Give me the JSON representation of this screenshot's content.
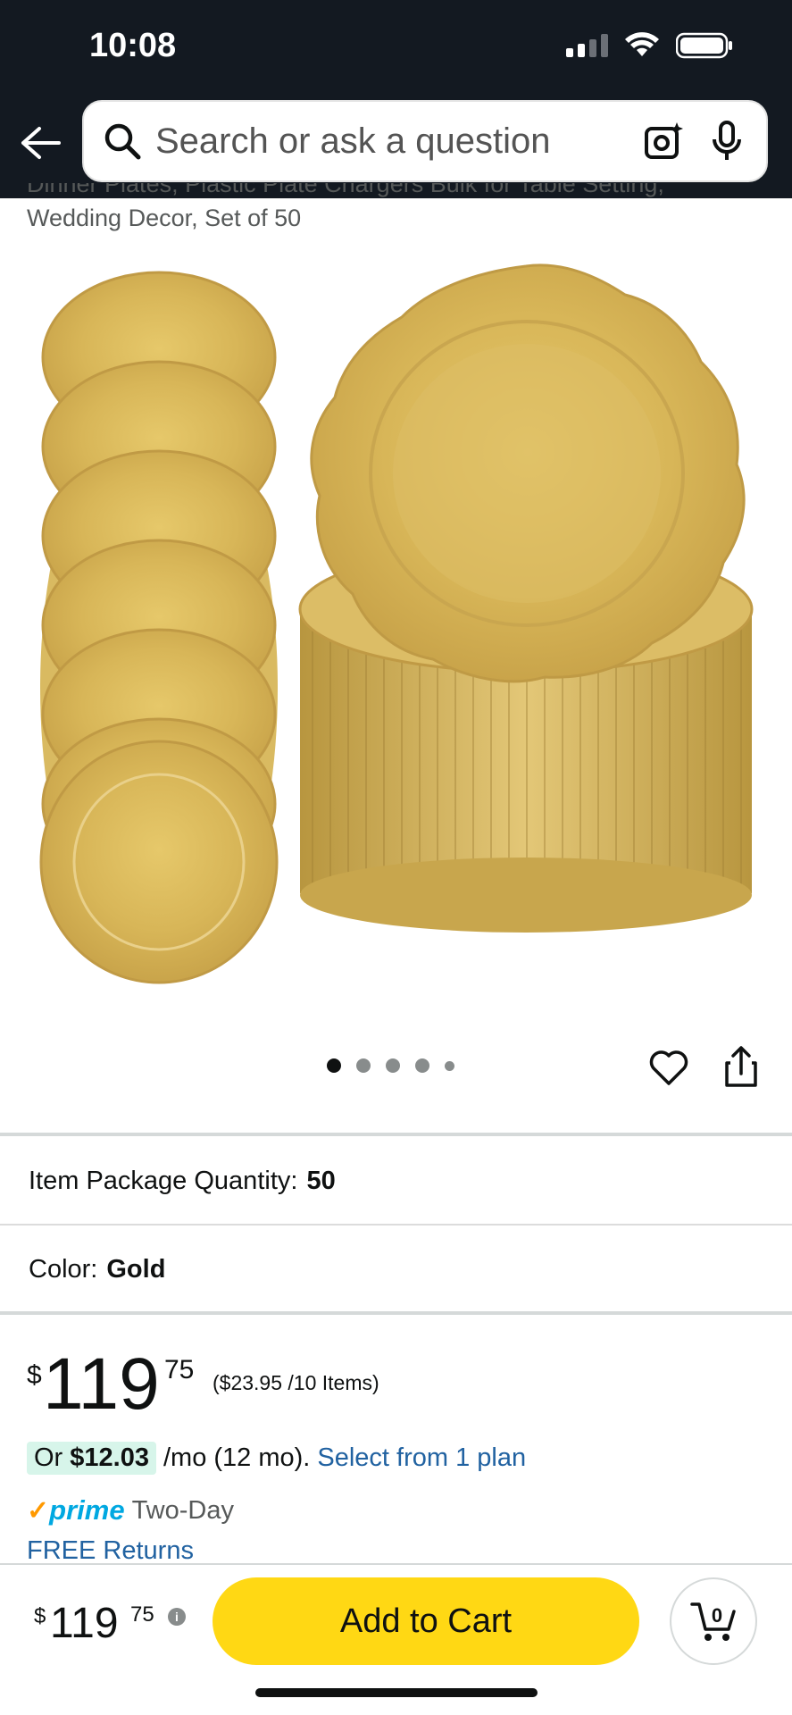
{
  "status_bar": {
    "time": "10:08",
    "icons": [
      "signal-icon",
      "wifi-icon",
      "battery-icon"
    ]
  },
  "header": {
    "back_icon": "back-arrow-icon",
    "search_placeholder": "Search or ask a question",
    "camera_icon": "camera-icon",
    "mic_icon": "mic-icon"
  },
  "product": {
    "title_line1": "Dinner Plates, Plastic Plate Chargers Bulk for Table Setting,",
    "title_line2": "Wedding Decor, Set of 50",
    "image_alt": "gold-charger-plates-image",
    "carousel": {
      "dot_count": 5,
      "active_index": 0
    },
    "actions": {
      "favorite_icon": "heart-icon",
      "share_icon": "share-icon"
    }
  },
  "options": {
    "package_quantity_label": "Item Package Quantity:",
    "package_quantity_value": "50",
    "color_label": "Color:",
    "color_value": "Gold"
  },
  "price": {
    "symbol": "$",
    "whole": "119",
    "fraction": "75",
    "unit_price": "($23.95 /10 Items)"
  },
  "installment": {
    "prefix": "Or ",
    "amount": "$12.03",
    "term": "/mo (12 mo).",
    "link": "Select from 1 plan"
  },
  "shipping": {
    "check": "✓",
    "prime": "prime",
    "speed": "Two-Day",
    "returns": "FREE Returns"
  },
  "bottom_bar": {
    "symbol": "$",
    "whole": "119",
    "fraction": "75",
    "info": "i",
    "add_to_cart": "Add to Cart",
    "cart_count": "0"
  },
  "colors": {
    "header_bg": "#131921",
    "add_to_cart_bg": "#ffd814",
    "link": "#2162a1",
    "prime_blue": "#00a8e1",
    "prime_check": "#ff9900",
    "installment_badge": "#d7f5ea",
    "gold_light": "#e9cf7c",
    "gold_mid": "#d4b45a",
    "gold_dark": "#b8963f"
  }
}
